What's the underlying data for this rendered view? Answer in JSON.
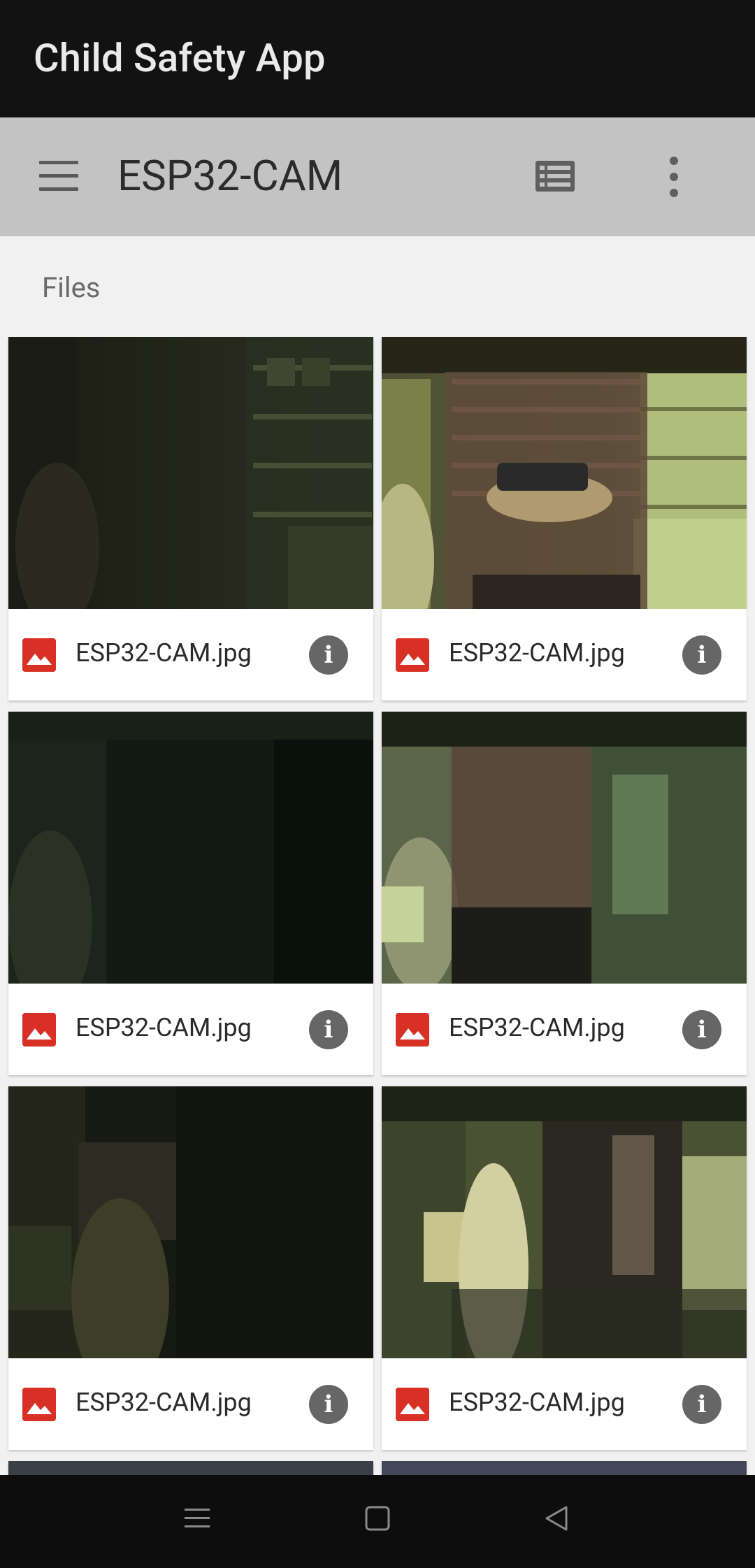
{
  "app_bar": {
    "title": "Child Safety App"
  },
  "toolbar": {
    "menu_icon": "hamburger-menu-icon",
    "folder_title": "ESP32-CAM",
    "view_icon": "list-view-icon",
    "more_icon": "more-vert-icon"
  },
  "section": {
    "label": "Files"
  },
  "files": [
    {
      "name": "ESP32-CAM.jpg",
      "type_icon": "image-file-icon",
      "info_icon": "info-icon"
    },
    {
      "name": "ESP32-CAM.jpg",
      "type_icon": "image-file-icon",
      "info_icon": "info-icon"
    },
    {
      "name": "ESP32-CAM.jpg",
      "type_icon": "image-file-icon",
      "info_icon": "info-icon"
    },
    {
      "name": "ESP32-CAM.jpg",
      "type_icon": "image-file-icon",
      "info_icon": "info-icon"
    },
    {
      "name": "ESP32-CAM.jpg",
      "type_icon": "image-file-icon",
      "info_icon": "info-icon"
    },
    {
      "name": "ESP32-CAM.jpg",
      "type_icon": "image-file-icon",
      "info_icon": "info-icon"
    }
  ],
  "nav_bar": {
    "buttons": [
      "recents-icon",
      "home-icon",
      "back-icon"
    ]
  },
  "colors": {
    "app_bar_bg": "#121212",
    "toolbar_bg": "#c3c3c3",
    "page_bg": "#f1f1f1",
    "file_icon": "#d93025",
    "info_icon": "#666666"
  }
}
